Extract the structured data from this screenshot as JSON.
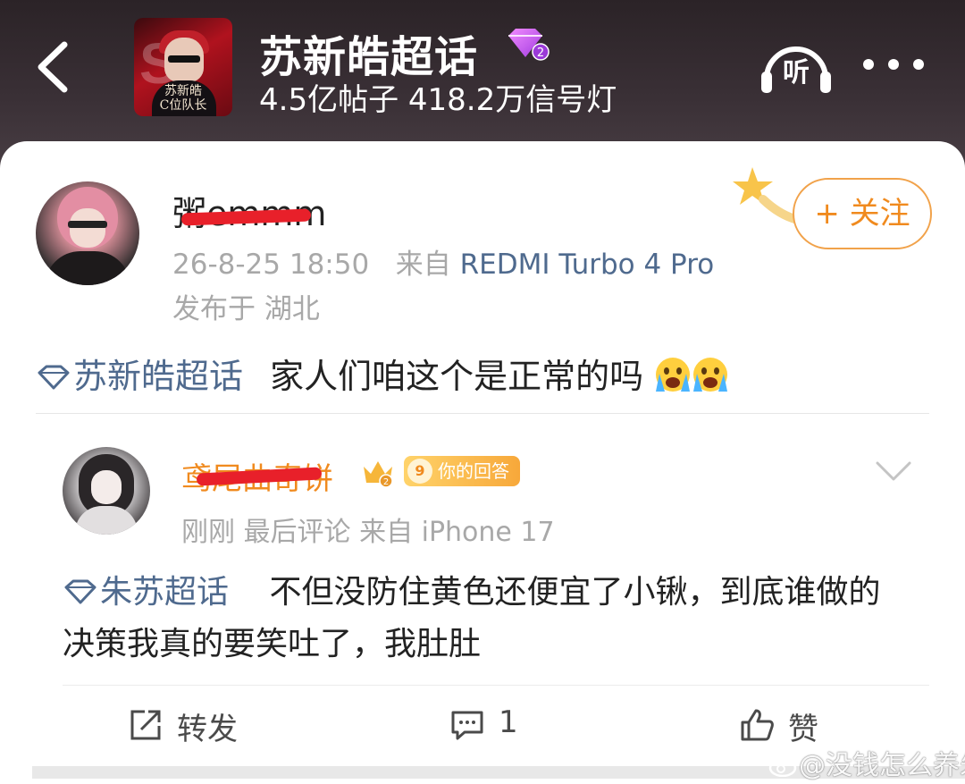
{
  "header": {
    "title": "苏新皓超话",
    "gem_level": "2",
    "stats": "4.5亿帖子 418.2万信号灯",
    "cover": {
      "line1": "苏新皓",
      "line2": "C位队长",
      "big": "S"
    },
    "listen_label": "听"
  },
  "post": {
    "username": "粥emmm",
    "time": "26-8-25 18:50",
    "source_prefix": "来自",
    "device": "REDMI Turbo 4 Pro",
    "location": "发布于 湖北",
    "follow_label": "+ 关注",
    "topic": "苏新皓超话",
    "text": "家人们咱这个是正常的吗"
  },
  "comment": {
    "username": "鸢尾曲奇饼",
    "level": "9",
    "badge_label": "你的回答",
    "meta": "刚刚 最后评论  来自 iPhone 17",
    "topic": "朱苏超话",
    "text": "不但没防住黄色还便宜了小锹，到底谁做的决策我真的要笑吐了，我肚肚"
  },
  "actions": {
    "repost_label": "转发",
    "comment_count": "1",
    "like_label": "赞"
  },
  "watermark": "@没钱怎么养朱",
  "colors": {
    "link": "#4f6a8e",
    "accent_orange": "#f08a1e",
    "meta_gray": "#a8a8a8",
    "redaction": "#e8202a"
  }
}
